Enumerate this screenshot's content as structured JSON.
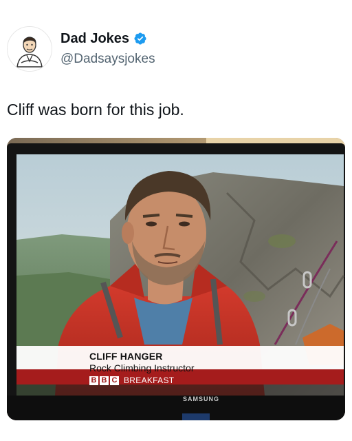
{
  "tweet": {
    "author_name": "Dad Jokes",
    "handle": "@Dadsaysjokes",
    "verified_icon": "verified-badge-icon",
    "text": "Cliff was born for this job."
  },
  "photo": {
    "caption_name": "CLIFF HANGER",
    "caption_role": "Rock Climbing Instructor",
    "channel_letters": [
      "B",
      "B",
      "C"
    ],
    "programme": "BREAKFAST",
    "tv_brand": "SAMSUNG"
  },
  "colors": {
    "verified": "#1d9bf0",
    "bbc_red": "#9e1717",
    "text_primary": "#0f1419",
    "text_secondary": "#536471"
  }
}
